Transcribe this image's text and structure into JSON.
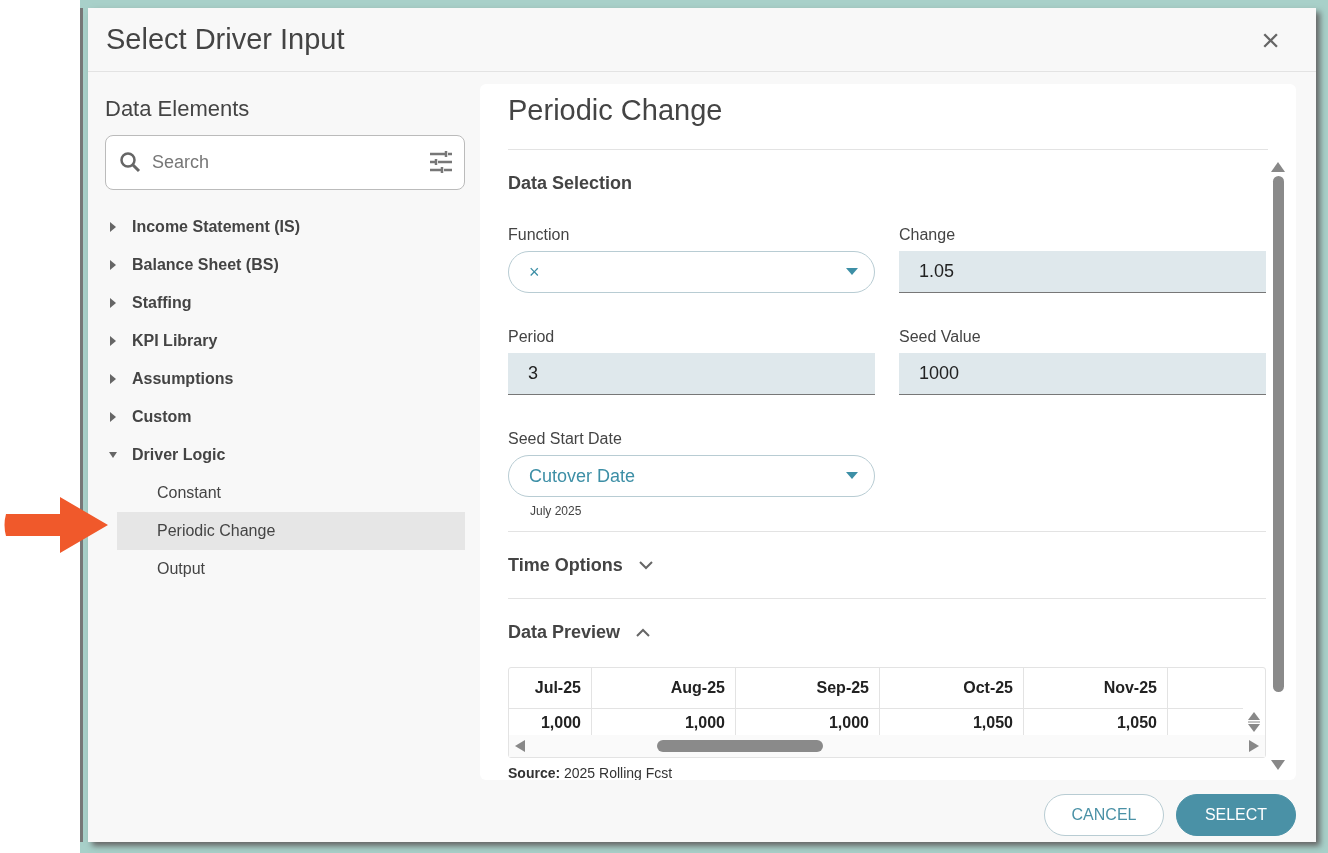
{
  "dialog": {
    "title": "Select Driver Input",
    "close": "×"
  },
  "sidebar": {
    "title": "Data Elements",
    "search": {
      "placeholder": "Search"
    },
    "tree": [
      {
        "label": "Income Statement (IS)",
        "expanded": false,
        "selected": false
      },
      {
        "label": "Balance Sheet (BS)",
        "expanded": false,
        "selected": false
      },
      {
        "label": "Staffing",
        "expanded": false,
        "selected": false
      },
      {
        "label": "KPI Library",
        "expanded": false,
        "selected": false
      },
      {
        "label": "Assumptions",
        "expanded": false,
        "selected": false
      },
      {
        "label": "Custom",
        "expanded": false,
        "selected": false
      },
      {
        "label": "Driver Logic",
        "expanded": true,
        "selected": false,
        "children": [
          {
            "label": "Constant",
            "selected": false
          },
          {
            "label": "Periodic Change",
            "selected": true
          },
          {
            "label": "Output",
            "selected": false
          }
        ]
      }
    ]
  },
  "panel": {
    "title": "Periodic Change",
    "data_selection": {
      "title": "Data Selection",
      "fields": [
        {
          "label": "Function",
          "kind": "select",
          "value": "×"
        },
        {
          "label": "Change",
          "kind": "text",
          "value": "1.05"
        },
        {
          "label": "Period",
          "kind": "text",
          "value": "3"
        },
        {
          "label": "Seed Value",
          "kind": "text",
          "value": "1000"
        },
        {
          "label": "Seed Start Date",
          "kind": "select",
          "value": "Cutover Date",
          "hint": "July 2025"
        }
      ]
    },
    "time_options": {
      "title": "Time Options",
      "expanded": false
    },
    "data_preview": {
      "title": "Data Preview",
      "expanded": true,
      "table": {
        "columns": [
          "Jul-25",
          "Aug-25",
          "Sep-25",
          "Oct-25",
          "Nov-25"
        ],
        "rows": [
          [
            "1,000",
            "1,000",
            "1,000",
            "1,050",
            "1,050"
          ]
        ]
      },
      "source": {
        "label": "Source:",
        "value": "2025 Rolling Fcst"
      }
    }
  },
  "buttons": [
    {
      "label": "CANCEL",
      "kind": "secondary"
    },
    {
      "label": "SELECT",
      "kind": "primary"
    }
  ]
}
